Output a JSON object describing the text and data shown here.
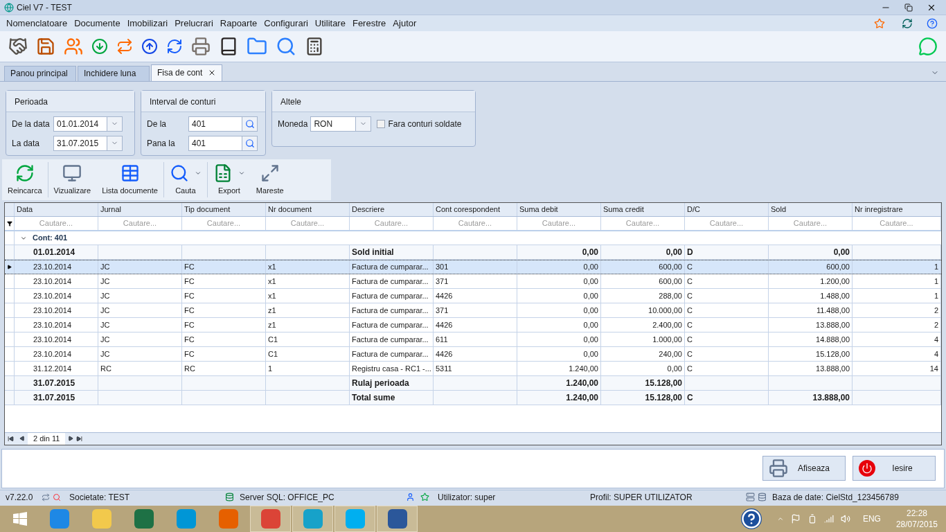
{
  "window": {
    "title": "Ciel V7 - TEST"
  },
  "menu": [
    "Nomenclatoare",
    "Documente",
    "Imobilizari",
    "Prelucrari",
    "Rapoarte",
    "Configurari",
    "Utilitare",
    "Ferestre",
    "Ajutor"
  ],
  "tabs": [
    {
      "label": "Panou principal",
      "selected": false,
      "closable": false
    },
    {
      "label": "Inchidere luna",
      "selected": false,
      "closable": false
    },
    {
      "label": "Fisa de cont",
      "selected": true,
      "closable": true
    }
  ],
  "filters": {
    "period": {
      "title": "Perioada",
      "from_label": "De la data",
      "from_value": "01.01.2014",
      "to_label": "La data",
      "to_value": "31.07.2015"
    },
    "accounts": {
      "title": "Interval de conturi",
      "from_label": "De la",
      "from_value": "401",
      "to_label": "Pana la",
      "to_value": "401"
    },
    "other": {
      "title": "Altele",
      "currency_label": "Moneda",
      "currency_value": "RON",
      "checkbox_label": "Fara conturi soldate",
      "checked": false
    }
  },
  "actions": [
    {
      "kind": "reload",
      "label": "Reincarca",
      "dropdown": false
    },
    {
      "kind": "view",
      "label": "Vizualizare",
      "dropdown": false
    },
    {
      "kind": "list",
      "label": "Lista documente",
      "dropdown": false
    },
    {
      "kind": "search",
      "label": "Cauta",
      "dropdown": true
    },
    {
      "kind": "export",
      "label": "Export",
      "dropdown": true
    },
    {
      "kind": "zoom",
      "label": "Mareste",
      "dropdown": false
    }
  ],
  "grid": {
    "columns": [
      {
        "label": "Data",
        "search_placeholder": "Cautare..."
      },
      {
        "label": "Jurnal",
        "search_placeholder": "Cautare..."
      },
      {
        "label": "Tip document",
        "search_placeholder": "Cautare..."
      },
      {
        "label": "Nr document",
        "search_placeholder": "Cautare..."
      },
      {
        "label": "Descriere",
        "search_placeholder": "Cautare..."
      },
      {
        "label": "Cont corespondent",
        "search_placeholder": "Cautare..."
      },
      {
        "label": "Suma debit",
        "search_placeholder": "Cautare..."
      },
      {
        "label": "Suma credit",
        "search_placeholder": "Cautare..."
      },
      {
        "label": "D/C",
        "search_placeholder": "Cautare..."
      },
      {
        "label": "Sold",
        "search_placeholder": "Cautare..."
      },
      {
        "label": "Nr inregistrare",
        "search_placeholder": "Cautare..."
      }
    ],
    "group": {
      "label": "Cont: 401",
      "expanded": true
    },
    "rows": [
      {
        "kind": "total",
        "selected": false,
        "cells": [
          "01.01.2014",
          null,
          null,
          null,
          "Sold initial",
          null,
          "0,00",
          "0,00",
          "D",
          "0,00",
          null
        ]
      },
      {
        "kind": "data",
        "selected": true,
        "cells": [
          "23.10.2014",
          "JC",
          "FC",
          "x1",
          "Factura de cumparar...",
          "301",
          "0,00",
          "600,00",
          "C",
          "600,00",
          "1"
        ]
      },
      {
        "kind": "data",
        "selected": false,
        "cells": [
          "23.10.2014",
          "JC",
          "FC",
          "x1",
          "Factura de cumparar...",
          "371",
          "0,00",
          "600,00",
          "C",
          "1.200,00",
          "1"
        ]
      },
      {
        "kind": "data",
        "selected": false,
        "cells": [
          "23.10.2014",
          "JC",
          "FC",
          "x1",
          "Factura de cumparar...",
          "4426",
          "0,00",
          "288,00",
          "C",
          "1.488,00",
          "1"
        ]
      },
      {
        "kind": "data",
        "selected": false,
        "cells": [
          "23.10.2014",
          "JC",
          "FC",
          "z1",
          "Factura de cumparar...",
          "371",
          "0,00",
          "10.000,00",
          "C",
          "11.488,00",
          "2"
        ]
      },
      {
        "kind": "data",
        "selected": false,
        "cells": [
          "23.10.2014",
          "JC",
          "FC",
          "z1",
          "Factura de cumparar...",
          "4426",
          "0,00",
          "2.400,00",
          "C",
          "13.888,00",
          "2"
        ]
      },
      {
        "kind": "data",
        "selected": false,
        "cells": [
          "23.10.2014",
          "JC",
          "FC",
          "C1",
          "Factura de cumparar...",
          "611",
          "0,00",
          "1.000,00",
          "C",
          "14.888,00",
          "4"
        ]
      },
      {
        "kind": "data",
        "selected": false,
        "cells": [
          "23.10.2014",
          "JC",
          "FC",
          "C1",
          "Factura de cumparar...",
          "4426",
          "0,00",
          "240,00",
          "C",
          "15.128,00",
          "4"
        ]
      },
      {
        "kind": "data",
        "selected": false,
        "cells": [
          "31.12.2014",
          "RC",
          "RC",
          "1",
          "Registru casa - RC1 -...",
          "5311",
          "1.240,00",
          "0,00",
          "C",
          "13.888,00",
          "14"
        ]
      },
      {
        "kind": "total",
        "selected": false,
        "cells": [
          "31.07.2015",
          null,
          null,
          null,
          "Rulaj perioada",
          null,
          "1.240,00",
          "15.128,00",
          null,
          null,
          null
        ]
      },
      {
        "kind": "total",
        "selected": false,
        "cells": [
          "31.07.2015",
          null,
          null,
          null,
          "Total sume",
          null,
          "1.240,00",
          "15.128,00",
          "C",
          "13.888,00",
          null
        ]
      }
    ],
    "pager": "2 din 11"
  },
  "buttons": [
    {
      "kind": "print",
      "label": "Afiseaza"
    },
    {
      "kind": "exit",
      "label": "Iesire"
    }
  ],
  "status_bar": {
    "version": "v7.22.0",
    "company": "Societate: TEST",
    "server": "Server SQL: OFFICE_PC",
    "user": "Utilizator: super",
    "profile": "Profil: SUPER UTILIZATOR",
    "database": "Baza de date: CielStd_123456789"
  },
  "taskbar": {
    "apps": [
      {
        "kind": "ie",
        "selected": false
      },
      {
        "kind": "files",
        "selected": false
      },
      {
        "kind": "excel",
        "selected": false
      },
      {
        "kind": "hp",
        "selected": false
      },
      {
        "kind": "firefox",
        "selected": false
      },
      {
        "kind": "chrome",
        "selected": true
      },
      {
        "kind": "ciel",
        "selected": true
      },
      {
        "kind": "skype",
        "selected": true
      },
      {
        "kind": "word",
        "selected": true
      }
    ],
    "language": "ENG",
    "time": "22:28",
    "date": "28/07/2015"
  }
}
